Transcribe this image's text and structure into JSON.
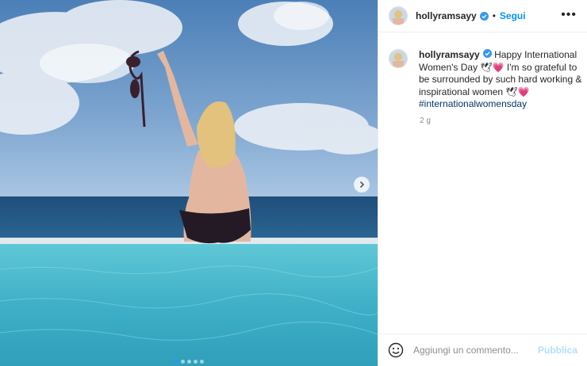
{
  "post": {
    "username": "hollyramsayy",
    "follow_label": "Segui",
    "separator": "•",
    "more_label": "•••",
    "caption_text": "Happy International Women's Day 🕊💗 I'm so grateful to be surrounded by such hard working & inspirational women 🕊💗",
    "hashtag": "#internationalwomensday",
    "time_ago": "2 g"
  },
  "comment": {
    "placeholder": "Aggiungi un commento...",
    "publish_label": "Pubblica"
  },
  "carousel": {
    "slide_count": 5,
    "active_index": 0
  },
  "icons": {
    "verified": "verified-badge-icon",
    "next": "chevron-right-icon",
    "emoji": "emoji-smile-icon",
    "more": "more-options-icon"
  },
  "colors": {
    "accent": "#0095f6",
    "publish_disabled": "#b2dffc",
    "hashtag": "#00376b"
  }
}
